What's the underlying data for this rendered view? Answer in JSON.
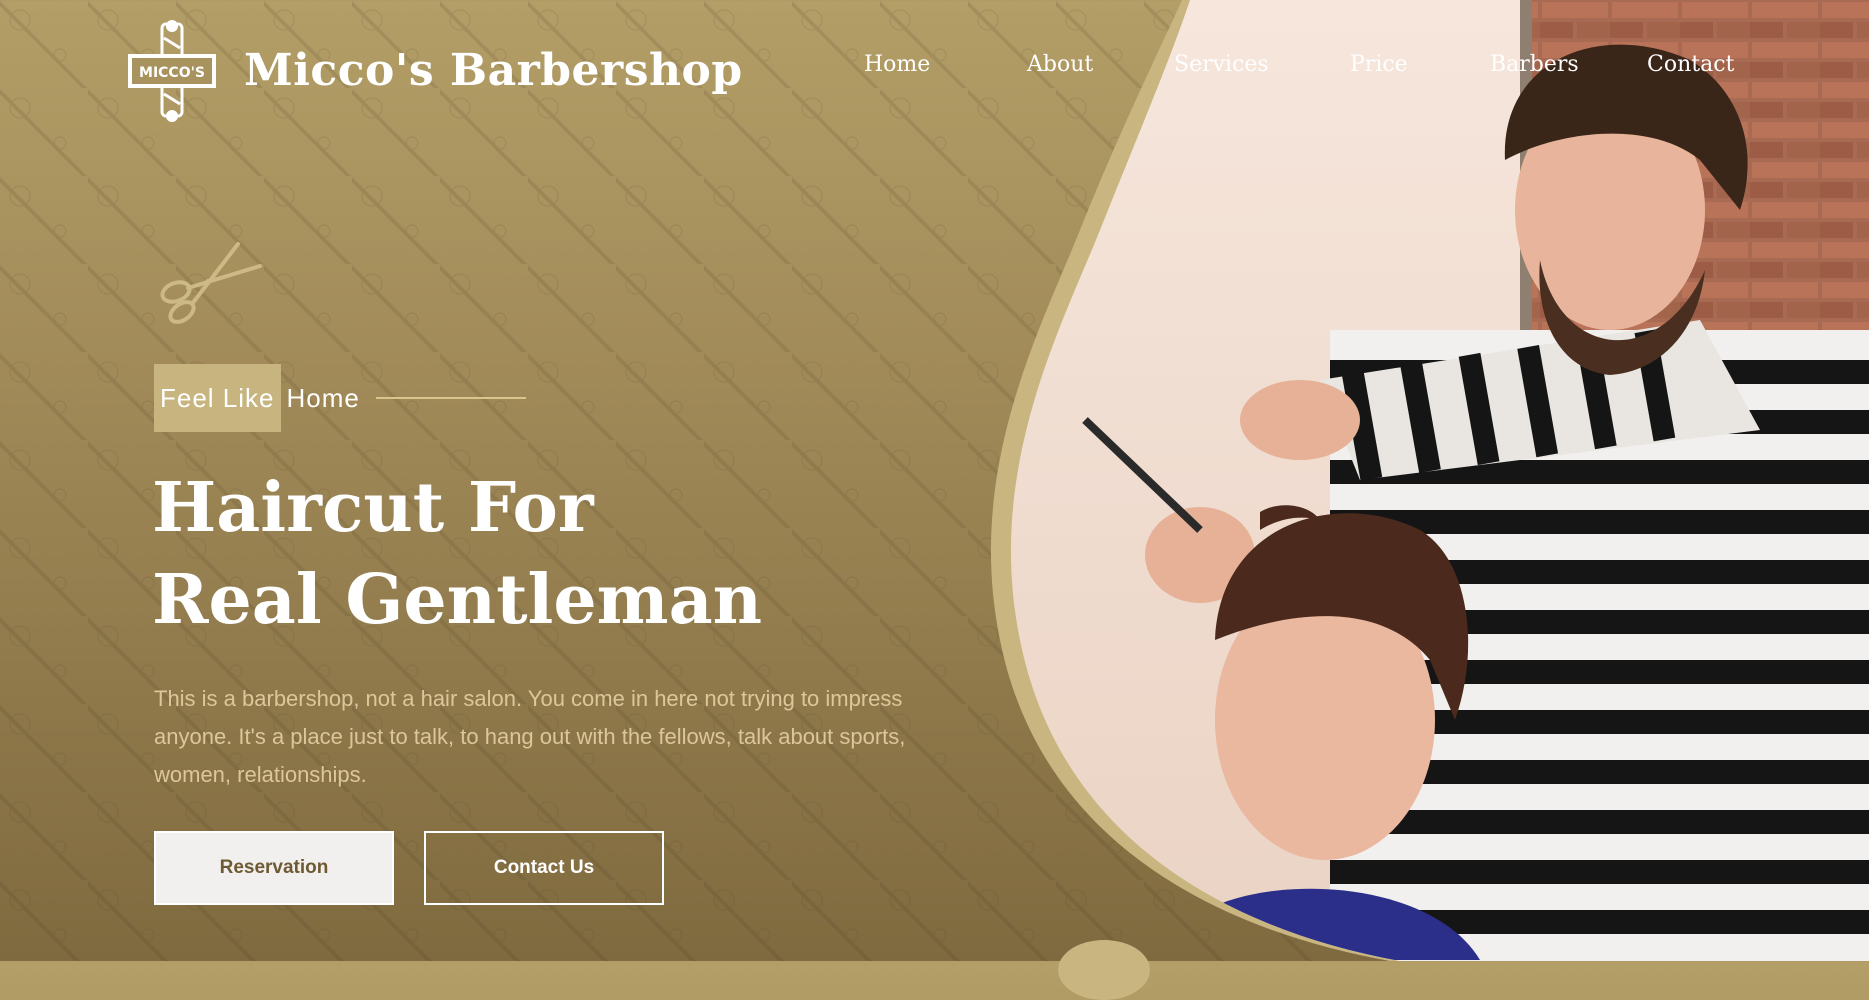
{
  "brand": {
    "badge_text": "MICCO'S",
    "name": "Micco's Barbershop"
  },
  "nav": {
    "items": [
      {
        "label": "Home"
      },
      {
        "label": "About"
      },
      {
        "label": "Services"
      },
      {
        "label": "Price"
      },
      {
        "label": "Barbers"
      },
      {
        "label": "Contact"
      }
    ]
  },
  "hero": {
    "tag_highlight": "Feel Like",
    "tag_rest": "Home",
    "title_line1": "Haircut For",
    "title_line2": "Real Gentleman",
    "description": "This is a barbershop, not a hair salon. You come in here not trying to impress anyone. It's a place just to talk, to hang out with the fellows, talk about sports, women, relationships.",
    "primary_button": "Reservation",
    "secondary_button": "Contact Us"
  },
  "colors": {
    "gold": "#c7b47e",
    "bg_top": "#b39e67",
    "bg_bottom": "#7f6a3f",
    "button_text": "#6e5a32",
    "body_text": "#dcc79a"
  },
  "icons": [
    "barber-pole-logo-icon",
    "scissors-icon"
  ]
}
